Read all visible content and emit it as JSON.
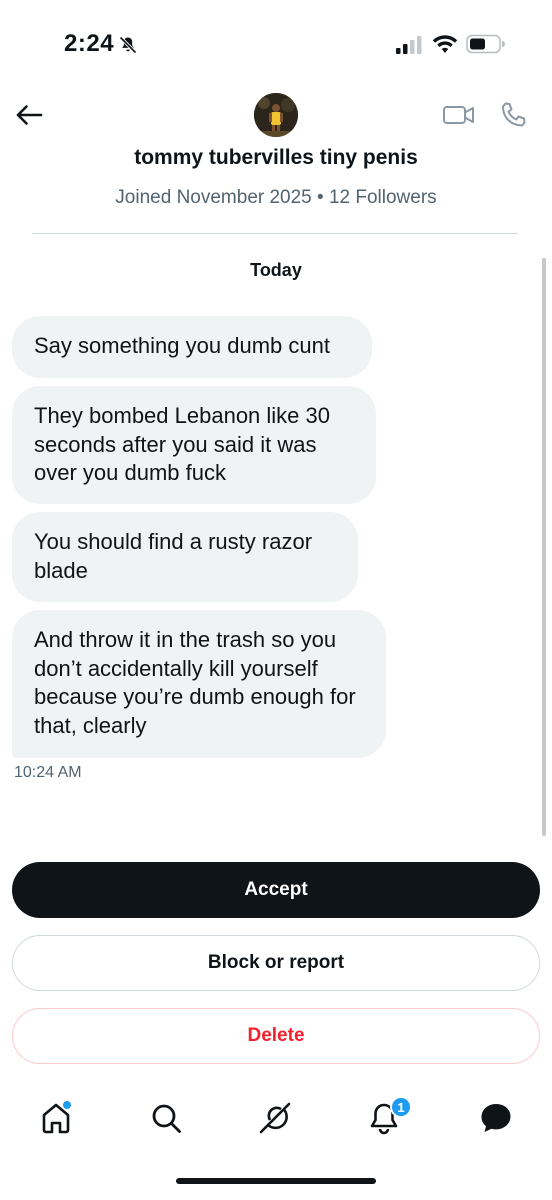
{
  "status_bar": {
    "time": "2:24",
    "icons": [
      "bell-slash-icon",
      "signal-icon",
      "wifi-icon",
      "battery-icon"
    ]
  },
  "header": {
    "back_icon": "arrow-left-icon",
    "avatar": "user-avatar",
    "video_icon": "video-camera-icon",
    "phone_icon": "phone-icon",
    "name": "tommy tubervilles tiny penis",
    "meta": "Joined November 2025 • 12 Followers"
  },
  "conversation": {
    "day_label": "Today",
    "messages": [
      {
        "text": "Say something you dumb cunt"
      },
      {
        "text": "They bombed Lebanon like 30 seconds after you said it was over you dumb fuck"
      },
      {
        "text": "You should find a rusty razor blade"
      },
      {
        "text": "And throw it in the trash so you don’t accidentally kill yourself because you’re dumb enough for that, clearly"
      }
    ],
    "timestamp": "10:24 AM"
  },
  "actions": {
    "accept": "Accept",
    "block_report": "Block or report",
    "delete": "Delete"
  },
  "tabbar": {
    "items": [
      "home-icon",
      "search-icon",
      "grok-icon",
      "notifications-icon",
      "messages-icon"
    ],
    "notification_count": "1"
  },
  "colors": {
    "text": "#0f1419",
    "muted": "#536471",
    "bubble": "#eff3f4",
    "accent": "#1d9bf0",
    "danger": "#f4212e"
  }
}
